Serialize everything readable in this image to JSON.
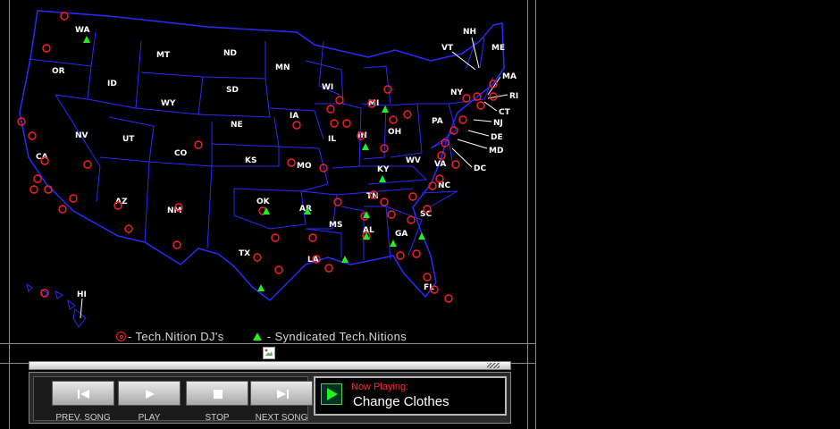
{
  "states": [
    "WA",
    "OR",
    "CA",
    "NV",
    "ID",
    "MT",
    "WY",
    "UT",
    "AZ",
    "CO",
    "NM",
    "ND",
    "SD",
    "NE",
    "KS",
    "OK",
    "TX",
    "MN",
    "IA",
    "MO",
    "AR",
    "LA",
    "WI",
    "IL",
    "MI",
    "IN",
    "OH",
    "KY",
    "TN",
    "MS",
    "AL",
    "GA",
    "FL",
    "SC",
    "NC",
    "VA",
    "WV",
    "PA",
    "NY",
    "VT",
    "NH",
    "ME",
    "MA",
    "RI",
    "CT",
    "NJ",
    "DE",
    "MD",
    "DC",
    "HI"
  ],
  "legend": {
    "dj_label": "- Tech.Nition DJ's",
    "syndicated_label": "- Syndicated Tech.Nitions",
    "dj_color": "#ff2020",
    "syndicated_color": "#22ee22"
  },
  "map_colors": {
    "borders": "#2a2aff",
    "labels": "#ffffff"
  },
  "player": {
    "buttons": [
      {
        "label": "PREV. SONG",
        "icon": "prev-icon"
      },
      {
        "label": "PLAY",
        "icon": "play-icon"
      },
      {
        "label": "STOP",
        "icon": "stop-icon"
      },
      {
        "label": "NEXT SONG",
        "icon": "next-icon"
      }
    ],
    "now_playing_label": "Now Playing:",
    "now_playing_title": "Change Clothes"
  }
}
